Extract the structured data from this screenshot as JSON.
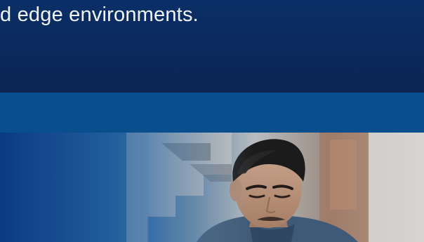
{
  "hero": {
    "text": "d edge environments."
  },
  "colors": {
    "hero_background": "#0b2a5e",
    "band_background": "#0a4f8d",
    "text": "#f2f6fb"
  },
  "photo": {
    "subject": "person-portrait-image"
  }
}
